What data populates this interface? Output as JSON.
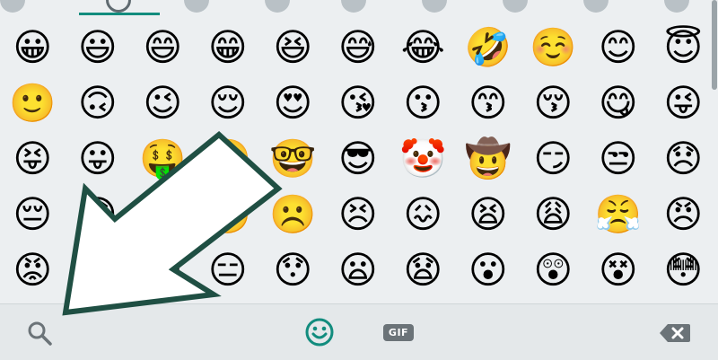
{
  "tabs": {
    "items": [
      "recent-icon",
      "smiley-icon",
      "animal-icon",
      "food-icon",
      "sport-icon",
      "car-icon",
      "lightbulb-icon",
      "symbols-icon",
      "flag-icon"
    ],
    "active_index": 1,
    "accent_color": "#128c7e"
  },
  "emoji_grid": {
    "rows": [
      [
        "😀",
        "😃",
        "😄",
        "😁",
        "😆",
        "😅",
        "😂",
        "🤣",
        "☺️",
        "😊",
        "😇"
      ],
      [
        "🙂",
        "🙃",
        "😉",
        "😌",
        "😍",
        "😘",
        "😗",
        "😙",
        "😚",
        "😋",
        "😜"
      ],
      [
        "😝",
        "😛",
        "🤑",
        "🤗",
        "🤓",
        "😎",
        "🤡",
        "🤠",
        "😏",
        "😒",
        "😞"
      ],
      [
        "😔",
        "😟",
        "😕",
        "🙁",
        "☹️",
        "😣",
        "😖",
        "😫",
        "😩",
        "😤",
        "😠"
      ],
      [
        "😡",
        "😶",
        "😐",
        "😑",
        "😯",
        "😦",
        "😧",
        "😮",
        "😲",
        "😵",
        "😳"
      ],
      [
        "😱",
        "😨",
        "😰",
        "😢",
        "😥",
        "🤤",
        "😭",
        "😓",
        "😪",
        "😴",
        "🙄"
      ]
    ]
  },
  "bottom_bar": {
    "gif_label": "GIF",
    "active_color": "#128c7e",
    "icon_color": "#6b7378"
  },
  "overlay": {
    "arrow_fill": "#ffffff",
    "arrow_stroke": "#1f4f43"
  }
}
